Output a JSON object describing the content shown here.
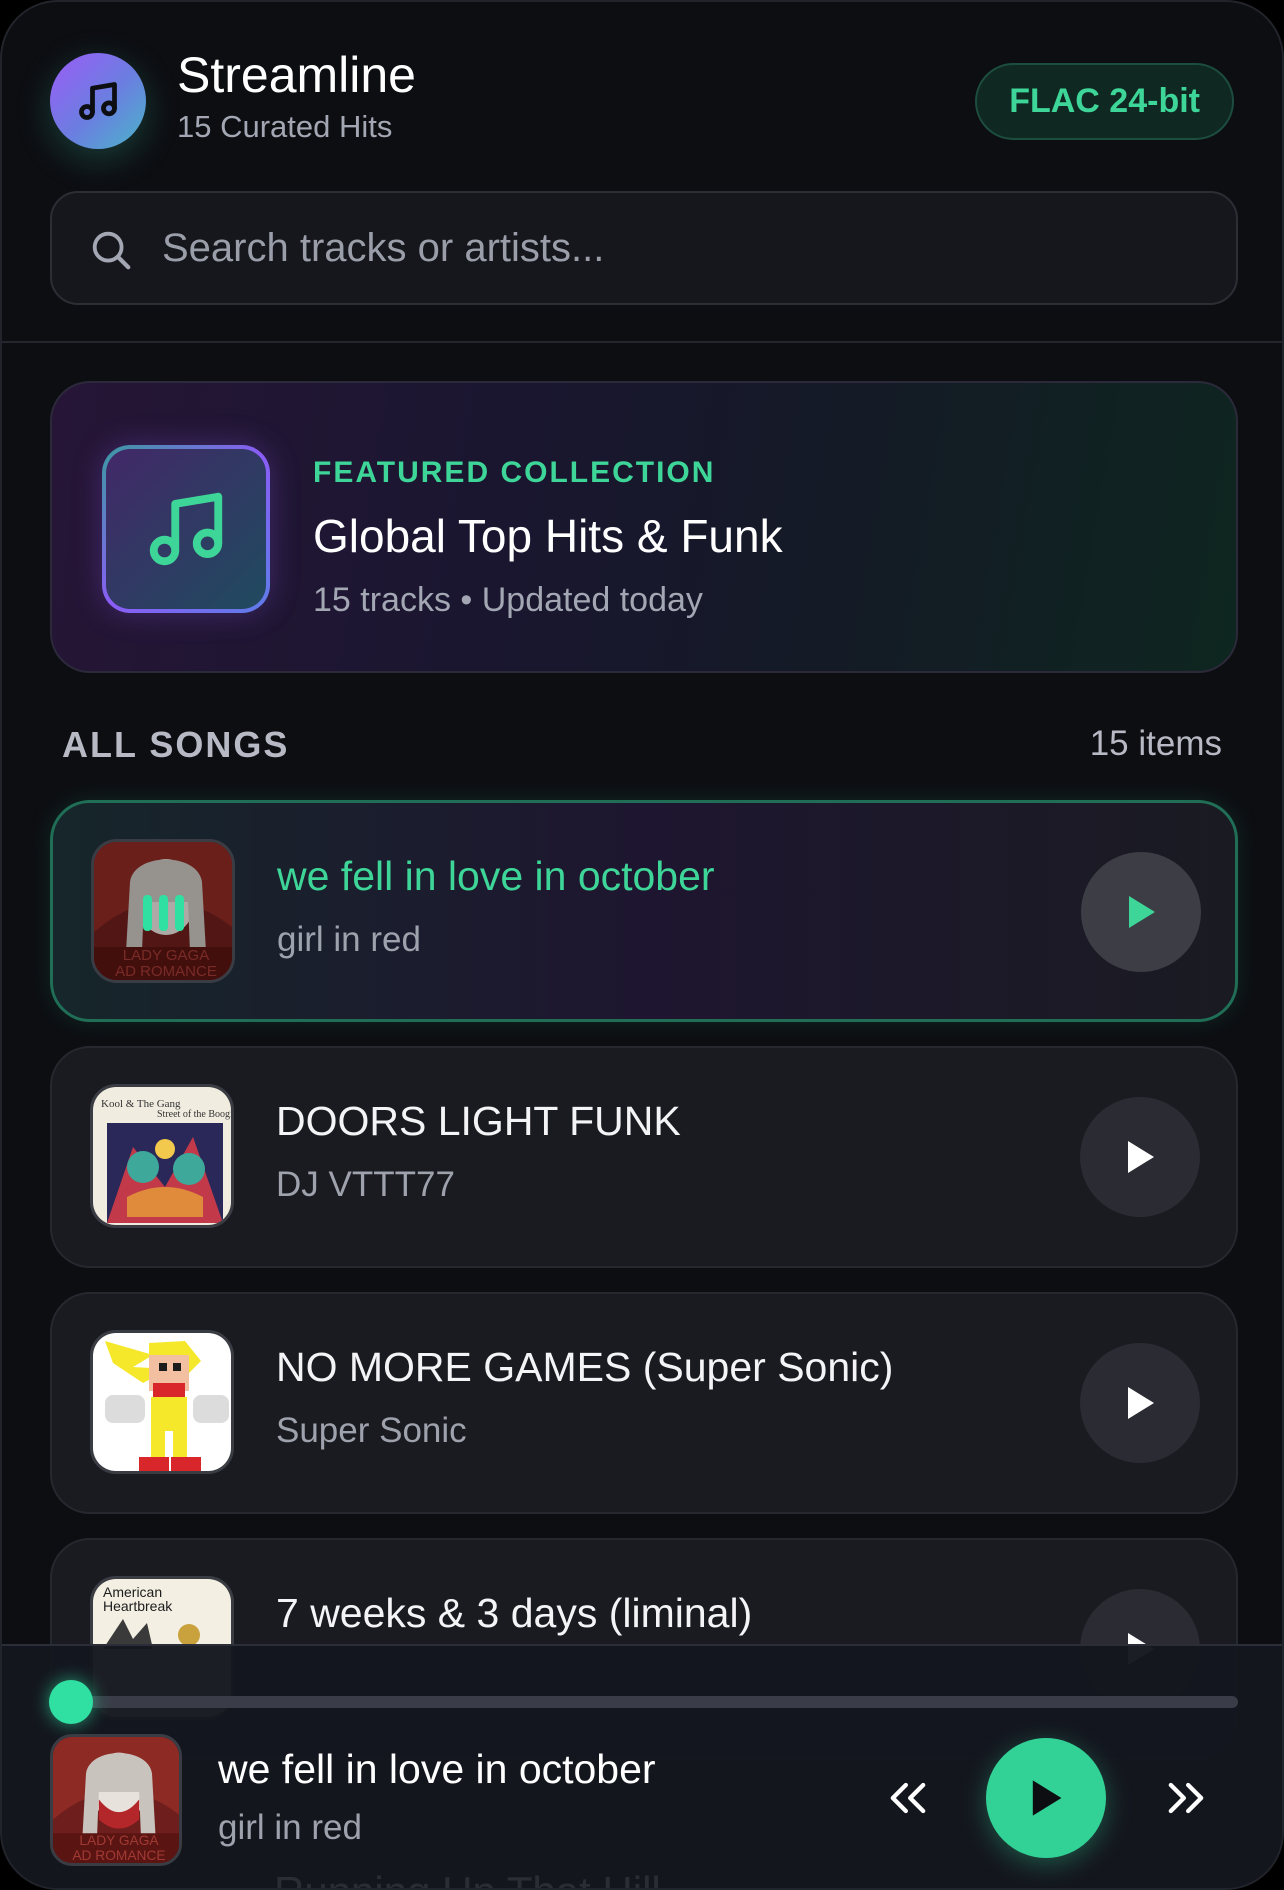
{
  "app": {
    "title": "Streamline",
    "subtitle": "15 Curated Hits",
    "quality_badge": "FLAC 24-bit",
    "accent_color": "#3ed598"
  },
  "search": {
    "placeholder": "Search tracks or artists...",
    "value": ""
  },
  "featured": {
    "label": "FEATURED COLLECTION",
    "title": "Global Top Hits & Funk",
    "meta": "15 tracks • Updated today"
  },
  "songs_section": {
    "title": "ALL SONGS",
    "count": "15 items",
    "items": [
      {
        "title": "we fell in love in october",
        "artist": "girl in red",
        "state": "playing"
      },
      {
        "title": "DOORS LIGHT FUNK",
        "artist": "DJ VTTT77",
        "state": "idle"
      },
      {
        "title": "NO MORE GAMES (Super Sonic)",
        "artist": "Super Sonic",
        "state": "idle"
      },
      {
        "title": "7 weeks & 3 days (liminal)",
        "artist": "",
        "state": "idle"
      }
    ]
  },
  "art_text": {
    "cover_1": "LADY GAGA",
    "cover_1b": "AD ROMANCE",
    "cover_2": "Kool & The Gang",
    "cover_2b": "Street of the Boogie",
    "cover_4": "American",
    "cover_4b": "Heartbreak"
  },
  "player": {
    "title": "we fell in love in october",
    "artist": "girl in red",
    "progress": 0.0,
    "next_up_ghost": "Running Up That Hill"
  },
  "icons": {
    "logo": "music-note-icon",
    "search": "search-icon",
    "play": "play-icon",
    "prev": "previous-icon",
    "next": "next-icon",
    "equalizer": "equalizer-icon"
  }
}
